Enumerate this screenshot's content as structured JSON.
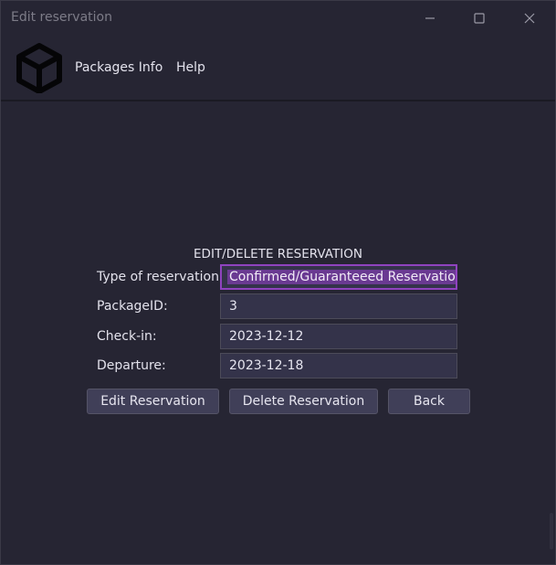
{
  "window": {
    "title": "Edit reservation",
    "controls": {
      "minimize_icon": "minimize-icon",
      "maximize_icon": "maximize-icon",
      "close_icon": "close-icon"
    }
  },
  "header": {
    "logo_icon": "cube-icon",
    "menu": [
      {
        "label": "Packages Info"
      },
      {
        "label": "Help"
      }
    ]
  },
  "form": {
    "title": "EDIT/DELETE RESERVATION",
    "fields": [
      {
        "label": "Type of reservation:",
        "value": "Confirmed/Guaranteeed Reservation",
        "selected": true
      },
      {
        "label": "PackageID:",
        "value": "3"
      },
      {
        "label": "Check-in:",
        "value": "2023-12-12"
      },
      {
        "label": "Departure:",
        "value": "2023-12-18"
      }
    ]
  },
  "buttons": {
    "edit": "Edit Reservation",
    "delete": "Delete Reservation",
    "back": "Back"
  },
  "colors": {
    "background": "#262533",
    "field_bg": "#34334a",
    "button_bg": "#403f58",
    "focus_border": "#8f43bf",
    "text": "#e3e2ec"
  }
}
